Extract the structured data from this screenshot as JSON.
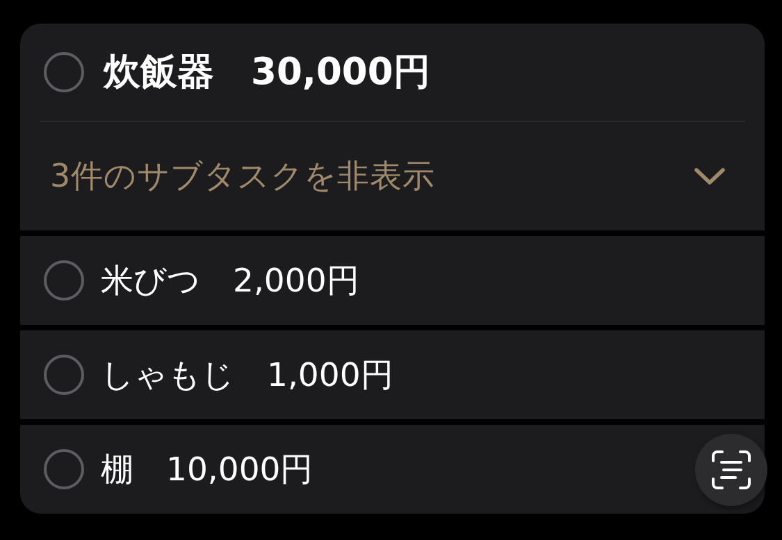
{
  "task": {
    "title": "炊飯器　30,000円",
    "completed": false
  },
  "subtasks_toggle": {
    "label": "3件のサブタスクを非表示",
    "expanded": true
  },
  "subtasks": [
    {
      "title": "米びつ　2,000円",
      "completed": false
    },
    {
      "title": "しゃもじ　1,000円",
      "completed": false
    },
    {
      "title": "棚　10,000円",
      "completed": false
    }
  ]
}
